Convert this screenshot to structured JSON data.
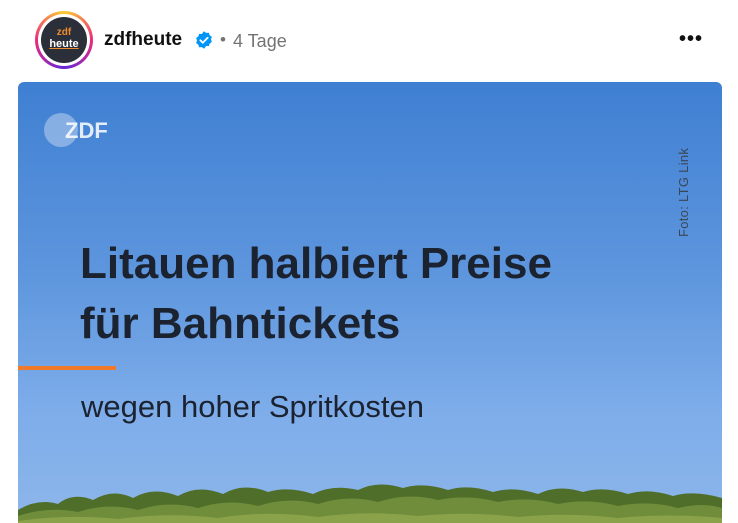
{
  "post": {
    "avatar": {
      "line1": "zdf",
      "line2": "heute"
    },
    "username": "zdfheute",
    "separator": "•",
    "time_ago": "4 Tage",
    "more_label": "•••",
    "image": {
      "logo_text": "ZDF",
      "photo_credit": "Foto: LTG Link",
      "headline_line1": "Litauen halbiert Preise",
      "headline_line2": "für Bahntickets",
      "subline": "wegen hoher Spritkosten"
    }
  },
  "colors": {
    "accent_orange": "#f07a2a",
    "verified_blue": "#0095f6",
    "headline_text": "#1b2230",
    "sky_top": "#3f7fd2",
    "sky_bottom": "#8db6ea"
  },
  "icons": {
    "verified": "verified-badge-icon",
    "more": "more-options-icon"
  }
}
